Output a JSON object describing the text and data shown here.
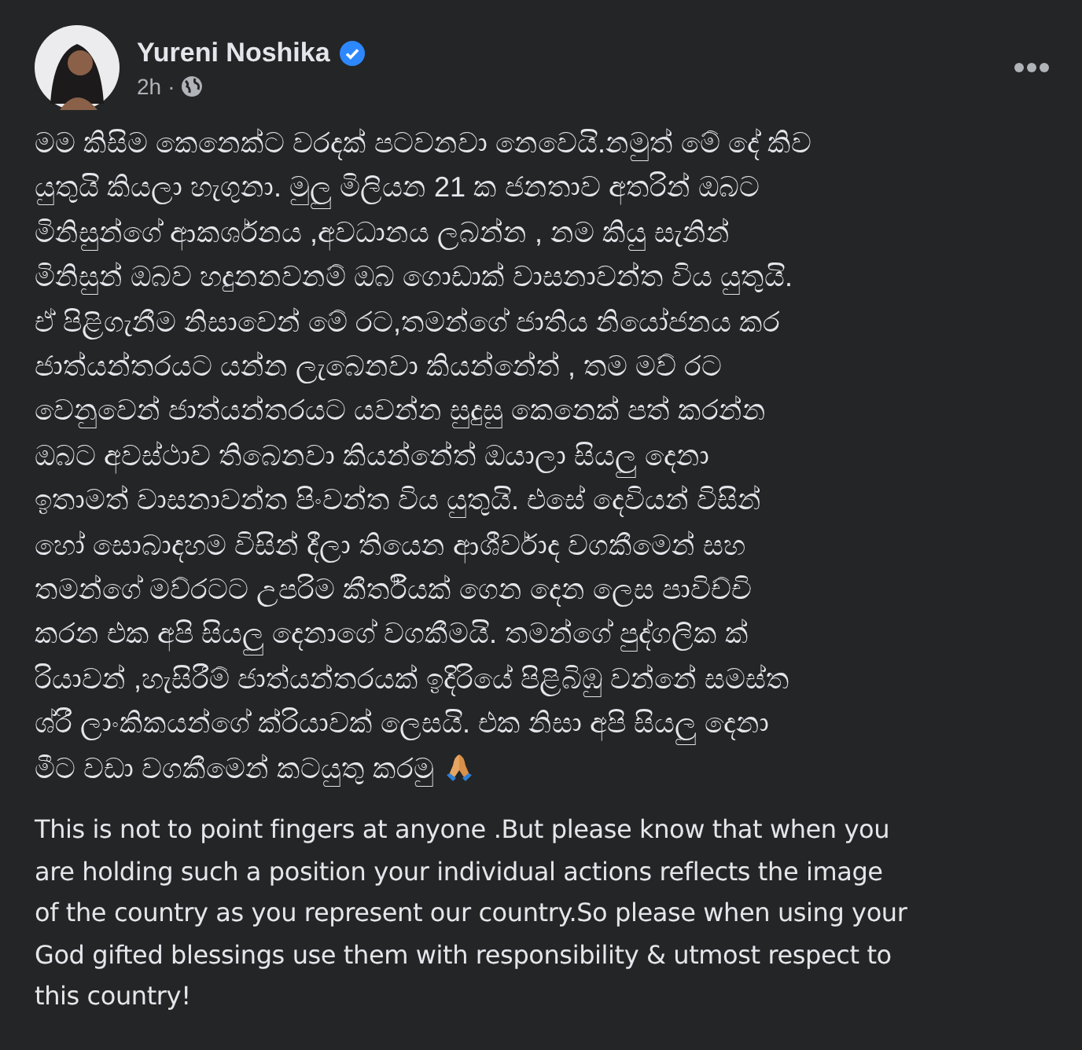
{
  "post": {
    "author": "Yureni Noshika",
    "verified": true,
    "time": "2h",
    "separator": "·",
    "audience": {
      "kind": "public"
    },
    "paragraphs": [
      {
        "kind": "sinhala",
        "text": "මම කිසිම කෙනෙක්ට වරදක් පටවනවා නෙවෙයි.නමුත් මේ දේ කිව\nයුතුයි කියලා හැගුනා. මුලු මිලියන 21 ක ජනතාව අතරින් ඔබට\nමිනිසුන්ගේ ආකර්ශනය ,අවධානය ලබන්න , නම කියු සැනින්\nමිනිසුන් ඔබව හදුනනවනම් ඔබ ගොඩාක් වාසනාවන්ත විය යුතුයි.\nඒ පිළිගැනීම නිසාවෙන් මේ රට,තමන්ගේ ජාතිය නියෝජනය කර\nජාත්යන්තරයට යන්න ලැබෙනවා කියන්නේත් , තම මව් රට\nවෙනුවෙන් ජාත්යන්තරයට යවන්න සුදුසු කෙනෙක් පත් කරන්න\nඔබට අවස්ථාව තිබෙනවා කියන්නේත් ඔයාලා සියලු දෙනා\nඉතාමත් වාසනාවන්ත පිංවන්ත විය යුතුයි. එසේ දෙවියන් විසින්\nහෝ සොබාදහම විසින් දීලා තියෙන ආශීර්වාද වගකීමෙන් සහ\nතමන්ගේ මව්රටට උපරිම කීර්තියක් ගෙන දෙන ලෙස පාවිච්චි\nකරන එක අපි සියලු දෙනාගේ වගකීමයි. තමන්ගේ පුද්ගලික ක්\nරියාවන් ,හැසිරීම් ජාත්යන්තරයක් ඉදිරියේ පිළිබිඹු වන්නේ සමස්ත\nශ්රී ලාංකිකයන්ගේ ක්රියාවක් ලෙසයි. එක නිසා අපි සියලු දෙනා\nමීට වඩා වගකීමෙන් කටයුතු කරමු",
        "end_icon": {
          "kind": "praying-hands"
        }
      },
      {
        "kind": "english",
        "text": "This is not to point fingers at anyone .But please know that when you\nare holding such a position your individual actions reflects the image\nof the country as you represent our country.So please when using your\nGod gifted blessings use them with responsibility & utmost respect to\nthis country!"
      }
    ]
  }
}
